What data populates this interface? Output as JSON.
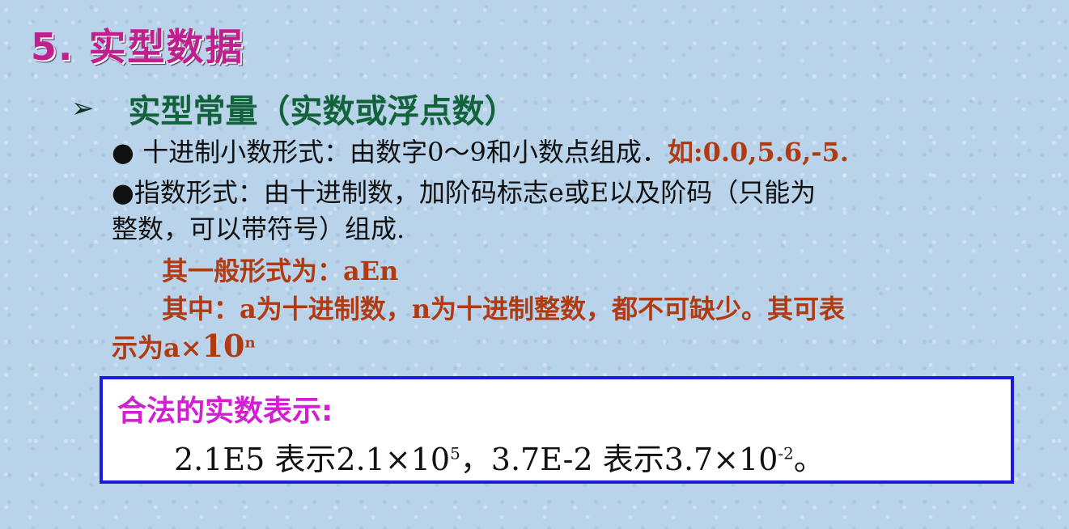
{
  "title": "5. 实型数据",
  "heading": {
    "bullet": "➢",
    "text": "实型常量（实数或浮点数）"
  },
  "decimal": {
    "text": "● 十进制小数形式：由数字0～9和小数点组成．",
    "example": "如:0.0,5.6,-5."
  },
  "exponent": {
    "line1": "●指数形式：由十进制数，加阶码标志e或E以及阶码（只能为",
    "line2": "整数，可以带符号）组成."
  },
  "general_form": "其一般形式为：aEn",
  "explanation": "其中：a为十进制数，n为十进制整数，都不可缺少。其可表",
  "represent": {
    "prefix": "示为a×",
    "base": "10",
    "exp": "n"
  },
  "box": {
    "title": "合法的实数表示:",
    "ex1": "2.1E5 表示2.1×10",
    "ex1_exp": "5",
    "sep": "，3.7E-2 表示3.7×10",
    "ex2_exp": "-2",
    "end": "。"
  }
}
